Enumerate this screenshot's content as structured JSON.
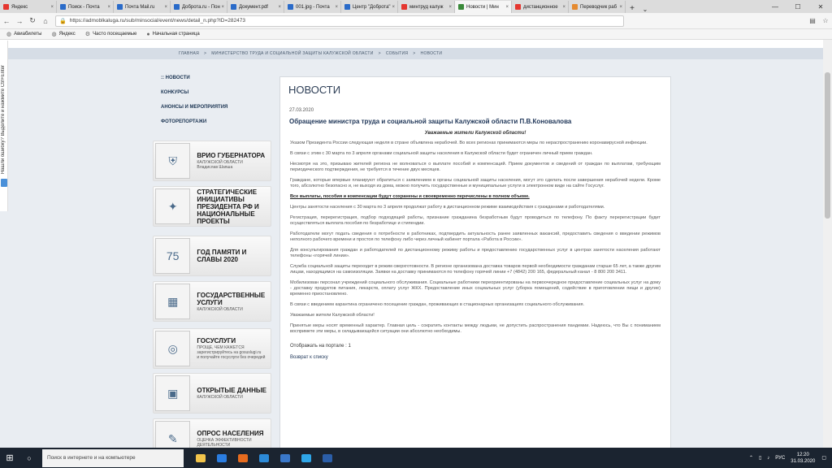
{
  "browser": {
    "tabs": [
      {
        "label": "Яндекс",
        "icon": "yandex-icon",
        "color": "#e5362f",
        "active": false
      },
      {
        "label": "Поиск - Почта",
        "icon": "mail-icon",
        "color": "#2a6bc9",
        "active": false
      },
      {
        "label": "Почта Mail.ru",
        "icon": "mail-icon",
        "color": "#2a6bc9",
        "active": false
      },
      {
        "label": "Доброта.ru - Пон",
        "icon": "mail-icon",
        "color": "#2a6bc9",
        "active": false
      },
      {
        "label": "Документ.pdf",
        "icon": "mail-icon",
        "color": "#2a6bc9",
        "active": false
      },
      {
        "label": "001.jpg - Почта",
        "icon": "mail-icon",
        "color": "#2a6bc9",
        "active": false
      },
      {
        "label": "Центр \"Доброта\"",
        "icon": "mail-icon",
        "color": "#2a6bc9",
        "active": false
      },
      {
        "label": "минтруд калуж",
        "icon": "yandex-icon",
        "color": "#e5362f",
        "active": false
      },
      {
        "label": "Новости | Мин",
        "icon": "site-icon",
        "color": "#3a8a3a",
        "active": true
      },
      {
        "label": "дистанционное",
        "icon": "yandex-icon",
        "color": "#e5362f",
        "active": false
      },
      {
        "label": "Переводчик раб",
        "icon": "translate-icon",
        "color": "#e58a2f",
        "active": false
      }
    ],
    "url": "https://admoblkaluga.ru/sub/minsocial/event/news/detail_n.php?ID=282473",
    "bookmarks": [
      {
        "label": "Авиабилеты",
        "icon": "globe-icon"
      },
      {
        "label": "Яндекс",
        "icon": "globe-icon"
      },
      {
        "label": "Часто посещаемые",
        "icon": "gear-icon"
      },
      {
        "label": "Начальная страница",
        "icon": "firefox-icon"
      }
    ]
  },
  "page": {
    "breadcrumb": [
      "ГЛАВНАЯ",
      ">",
      "МИНИСТЕРСТВО ТРУДА И СОЦИАЛЬНОЙ ЗАЩИТЫ КАЛУЖСКОЙ ОБЛАСТИ",
      ">",
      "СОБЫТИЯ",
      ">",
      "НОВОСТИ"
    ],
    "leftnav": [
      ":: НОВОСТИ",
      "КОНКУРСЫ",
      "АНОНСЫ И МЕРОПРИЯТИЯ",
      "ФОТОРЕПОРТАЖИ"
    ],
    "banners": [
      {
        "title": "ВРИО ГУБЕРНАТОРА",
        "sub": "КАЛУЖСКОЙ ОБЛАСТИ\nВладислав Шапша",
        "icon": "coat-of-arms-icon"
      },
      {
        "title": "СТРАТЕГИЧЕСКИЕ ИНИЦИАТИВЫ ПРЕЗИДЕНТА РФ И НАЦИОНАЛЬНЫЕ ПРОЕКТЫ",
        "sub": "",
        "icon": "eagle-icon"
      },
      {
        "title": "ГОД ПАМЯТИ И СЛАВЫ 2020",
        "sub": "",
        "icon": "victory-75-icon"
      },
      {
        "title": "ГОСУДАРСТВЕННЫЕ УСЛУГИ",
        "sub": "КАЛУЖСКОЙ ОБЛАСТИ",
        "icon": "services-icon"
      },
      {
        "title": "ГОСУСЛУГИ",
        "sub": "ПРОЩЕ, ЧЕМ КАЖЕТСЯ\nзарегистрируйтесь на gosuslugi.ru\nи получайте госуслуги без очередей",
        "icon": "gosuslugi-icon"
      },
      {
        "title": "ОТКРЫТЫЕ ДАННЫЕ",
        "sub": "КАЛУЖСКОЙ ОБЛАСТИ",
        "icon": "open-data-icon"
      },
      {
        "title": "ОПРОС НАСЕЛЕНИЯ",
        "sub": "ОЦЕНКА ЭФФЕКТИВНОСТИ ДЕЯТЕЛЬНОСТИ",
        "icon": "survey-icon"
      }
    ],
    "header": "НОВОСТИ",
    "date": "27.03.2020",
    "title": "Обращение министра труда и социальной защиты Калужской области П.В.Коновалова",
    "greeting": "Уважаемые жители Калужской области!",
    "paragraphs": [
      {
        "text": "Указом Президента России следующая неделя в стране объявлена нерабочей. Во всех регионах принимаются меры по нераспространению коронавирусной инфекции.",
        "bold": false
      },
      {
        "text": "В связи с этим с 30 марта по 3 апреля органами социальной защиты населения в Калужской области будет ограничен личный прием граждан.",
        "bold": false
      },
      {
        "text": "Несмотря на это, призываю жителей региона не волноваться о выплате пособий и компенсаций. Прием документов и сведений от граждан по выплатам, требующим периодического подтверждения, не требуется в течение двух месяцев.",
        "bold": false
      },
      {
        "text": "Граждане, которые впервые планируют обратиться с заявлением в органы социальной защиты населения, могут это сделать после завершения нерабочей недели. Кроме того, абсолютно безопасно и, не выходя из дома, можно получить государственные и муниципальные услуги в электронном виде на сайте Госуслуг.",
        "bold": false
      },
      {
        "text": "Все выплаты, пособия и компенсации будут сохранены и своевременно перечислены в полном объеме.",
        "bold": true
      },
      {
        "text": "Центры занятости населения с 30 марта по 3 апреля продолжат работу в дистанционном режиме взаимодействия с гражданами и работодателями.",
        "bold": false
      },
      {
        "text": "Регистрация, перерегистрация, подбор подходящей работы, признание гражданина безработным будут проводиться по телефону. По факту перерегистрации будет осуществляться выплата пособия по безработице и стипендии.",
        "bold": false
      },
      {
        "text": "Работодатели могут подать сведения о потребности в работниках, подтвердить актуальность ранее заявленных вакансий, предоставить сведения о введении режимов неполного рабочего времени и простоя по телефону либо через личный кабинет портала «Работа в России».",
        "bold": false
      },
      {
        "text": "Для консультирования граждан и работодателей по дистанционному режиму работы и предоставлению государственных услуг в центрах занятости населения работают телефоны «горячей линии».",
        "bold": false
      },
      {
        "text": "Служба социальной защиты переходит в режим сверхготовности. В регионе организована доставка товаров первой необходимости гражданам старше 65 лет, а также другим лицам, находящимся на самоизоляции. Заявки на доставку принимаются по телефону горячей линии +7 (4842) 200 165, федеральный канал - 8 800 200 3411.",
        "bold": false
      },
      {
        "text": "Мобилизован персонал учреждений социального обслуживания. Социальные работники переориентированы на первоочередное предоставление социальных услуг на дому - доставку продуктов питания, лекарств, оплату услуг ЖКХ. Предоставление иных социальных услуг (уборка помещений, содействие в приготовлении пищи и другие) временно приостановлено.",
        "bold": false
      },
      {
        "text": "В связи с введением карантина ограничено посещение граждан, проживающих в стационарных организациях социального обслуживания.",
        "bold": false
      },
      {
        "text": "Уважаемые жители Калужской области!",
        "bold": false
      },
      {
        "text": "Принятые меры носят временный характер. Главная цель - сократить контакты между людьми, не допустить распространения пандемии. Надеюсь, что Вы с пониманием воспримете эти меры, в складывающейся ситуации они абсолютно необходимы.",
        "bold": false
      }
    ],
    "portal_count": "Отображать на портале : 1",
    "back_link": "Возврат к списку"
  },
  "side_panel": {
    "label": "Нашли ошибку? Выделите и нажмите Ctrl+Enter"
  },
  "taskbar": {
    "search_placeholder": "Поиск в интернете и на компьютере",
    "apps": [
      {
        "icon": "explorer-icon",
        "color": "#f2c44b"
      },
      {
        "icon": "mail-app-icon",
        "color": "#2a7de1"
      },
      {
        "icon": "firefox-icon",
        "color": "#e66b1e"
      },
      {
        "icon": "edge-icon",
        "color": "#2c8ad8"
      },
      {
        "icon": "store-icon",
        "color": "#3a78c9"
      },
      {
        "icon": "skype-icon",
        "color": "#2fa6e8"
      },
      {
        "icon": "word-icon",
        "color": "#2b5ea8"
      }
    ],
    "lang": "РУС",
    "time": "12:20",
    "date": "31.03.2020"
  }
}
